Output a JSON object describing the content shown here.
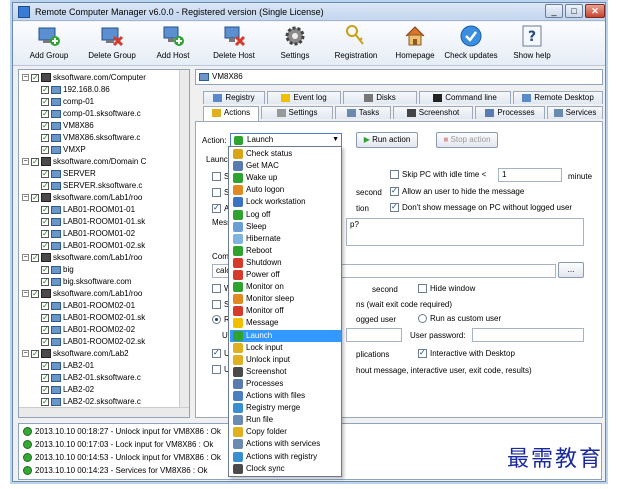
{
  "window": {
    "title": "Remote Computer Manager v6.0.0 - Registered version (Single License)",
    "controls": [
      "_",
      "□",
      "✕"
    ]
  },
  "toolbar": {
    "buttons": [
      {
        "label": "Add Group",
        "icon": "add-group-icon"
      },
      {
        "label": "Delete Group",
        "icon": "delete-group-icon"
      },
      {
        "label": "Add Host",
        "icon": "add-host-icon"
      },
      {
        "label": "Delete Host",
        "icon": "delete-host-icon"
      },
      {
        "label": "Settings",
        "icon": "gear-icon"
      },
      {
        "label": "Registration",
        "icon": "keys-icon"
      },
      {
        "label": "Homepage",
        "icon": "home-icon"
      },
      {
        "label": "Check updates",
        "icon": "check-icon"
      },
      {
        "label": "Show help",
        "icon": "help-icon"
      }
    ]
  },
  "tree": {
    "items": [
      {
        "label": "sksoftware.com/Computer",
        "type": "domain",
        "level": 0
      },
      {
        "label": "192.168.0.86",
        "type": "host",
        "level": 1
      },
      {
        "label": "comp-01",
        "type": "host",
        "level": 1
      },
      {
        "label": "comp-01.sksoftware.c",
        "type": "host",
        "level": 1
      },
      {
        "label": "VM8X86",
        "type": "host",
        "level": 1
      },
      {
        "label": "VM8X86.sksoftware.c",
        "type": "host",
        "level": 1
      },
      {
        "label": "VMXP",
        "type": "host",
        "level": 1
      },
      {
        "label": "sksoftware.com/Domain C",
        "type": "domain",
        "level": 0
      },
      {
        "label": "SERVER",
        "type": "host",
        "level": 1
      },
      {
        "label": "SERVER.sksoftware.c",
        "type": "host",
        "level": 1
      },
      {
        "label": "sksoftware.com/Lab1/roo",
        "type": "domain",
        "level": 0
      },
      {
        "label": "LAB01-ROOM01-01",
        "type": "host",
        "level": 1
      },
      {
        "label": "LAB01-ROOM01-01.sk",
        "type": "host",
        "level": 1
      },
      {
        "label": "LAB01-ROOM01-02",
        "type": "host",
        "level": 1
      },
      {
        "label": "LAB01-ROOM01-02.sk",
        "type": "host",
        "level": 1
      },
      {
        "label": "sksoftware.com/Lab1/roo",
        "type": "domain",
        "level": 0
      },
      {
        "label": "big",
        "type": "host",
        "level": 1
      },
      {
        "label": "big.sksoftware.com",
        "type": "host",
        "level": 1
      },
      {
        "label": "sksoftware.com/Lab1/roo",
        "type": "domain",
        "level": 0
      },
      {
        "label": "LAB01-ROOM02-01",
        "type": "host",
        "level": 1
      },
      {
        "label": "LAB01-ROOM02-01.sk",
        "type": "host",
        "level": 1
      },
      {
        "label": "LAB01-ROOM02-02",
        "type": "host",
        "level": 1
      },
      {
        "label": "LAB01-ROOM02-02.sk",
        "type": "host",
        "level": 1
      },
      {
        "label": "sksoftware.com/Lab2",
        "type": "domain",
        "level": 0
      },
      {
        "label": "LAB2-01",
        "type": "host",
        "level": 1
      },
      {
        "label": "LAB2-01.sksoftware.c",
        "type": "host",
        "level": 1
      },
      {
        "label": "LAB2-02",
        "type": "host",
        "level": 1
      },
      {
        "label": "LAB2-02.sksoftware.c",
        "type": "host",
        "level": 1
      }
    ]
  },
  "log": {
    "entries": [
      "2013.10.10 00:18:27 - Unlock input for VM8X86 : Ok",
      "2013.10.10 00:17:03 - Lock input for VM8X86 : Ok",
      "2013.10.10 00:14:53 - Unlock input for VM8X86 : Ok",
      "2013.10.10 00:14:23 - Services for VM8X86 : Ok"
    ]
  },
  "host": {
    "name": "VM8X86"
  },
  "tabs": {
    "row1": [
      "Registry",
      "Event log",
      "Disks",
      "Command line",
      "Remote Desktop"
    ],
    "row2": [
      "Actions",
      "Settings",
      "Tasks",
      "Screenshot",
      "Processes",
      "Services"
    ],
    "active": "Actions"
  },
  "actions": {
    "action_label": "Action:",
    "action_value": "Launch",
    "run_button": "Run action",
    "stop_button": "Stop action",
    "launch_label": "Launch",
    "skip_pc_label": "Skip PC with idle time <",
    "skip_pc_value": "1",
    "minute_label": "minute",
    "second_label1": "second",
    "allow_hide_label": "Allow an user to hide the message",
    "option_partial": "tion",
    "dont_show_label": "Don't show message on PC without logged user",
    "message_label": "Mess",
    "message_value": "p?",
    "command_label": "Comm",
    "command_value": "calc.",
    "browse_button": "...",
    "second_label2": "second",
    "hide_window_label": "Hide window",
    "wait_exit_label": "ns (wait exit code required)",
    "logged_user_label": "ogged user",
    "run_custom_label": "Run as custom user",
    "user_label": "U",
    "user_password_label": "User password:",
    "applications_label": "plications",
    "interactive_label": "Interactive with Desktop",
    "without_msg_label": "hout message, interactive user, exit code, results)",
    "partial_s1": "Sl",
    "partial_s2": "Sl",
    "partial_a": "A",
    "partial_w": "W",
    "partial_s3": "Sl",
    "partial_r": "R",
    "partial_u1": "U",
    "partial_u2": "U"
  },
  "dropdown": {
    "items": [
      {
        "label": "Check status",
        "color": "#d9a514"
      },
      {
        "label": "Get MAC",
        "color": "#5a7bb0"
      },
      {
        "label": "Wake up",
        "color": "#2fa32f"
      },
      {
        "label": "Auto logon",
        "color": "#e08a1f"
      },
      {
        "label": "Lock workstation",
        "color": "#3a74c2"
      },
      {
        "label": "Log off",
        "color": "#2fa32f"
      },
      {
        "label": "Sleep",
        "color": "#6a9fd6"
      },
      {
        "label": "Hibernate",
        "color": "#7fb3e0"
      },
      {
        "label": "Reboot",
        "color": "#2fa32f"
      },
      {
        "label": "Shutdown",
        "color": "#d63a2a"
      },
      {
        "label": "Power off",
        "color": "#d63a2a"
      },
      {
        "label": "Monitor on",
        "color": "#2fa32f"
      },
      {
        "label": "Monitor sleep",
        "color": "#e08a1f"
      },
      {
        "label": "Monitor off",
        "color": "#d63a2a"
      },
      {
        "label": "Message",
        "color": "#f0c000"
      },
      {
        "label": "Launch",
        "color": "#2fa32f"
      },
      {
        "label": "Lock input",
        "color": "#e0b020"
      },
      {
        "label": "Unlock input",
        "color": "#e0b020"
      },
      {
        "label": "Screenshot",
        "color": "#4a4a4a"
      },
      {
        "label": "Processes",
        "color": "#5a7bb0"
      },
      {
        "label": "Actions with files",
        "color": "#4a7fc0"
      },
      {
        "label": "Registry merge",
        "color": "#3a8fd0"
      },
      {
        "label": "Run file",
        "color": "#6a8ab0"
      },
      {
        "label": "Copy folder",
        "color": "#e0b020"
      },
      {
        "label": "Actions with services",
        "color": "#6a8ab0"
      },
      {
        "label": "Actions with registry",
        "color": "#3a8fd0"
      },
      {
        "label": "Clock sync",
        "color": "#4a4a4a"
      }
    ],
    "selected": "Launch"
  },
  "watermark": {
    "text": "最需教育"
  },
  "colors": {
    "accent": "#3399ff",
    "ok": "#36a836",
    "frame": "#6a8ab0"
  }
}
